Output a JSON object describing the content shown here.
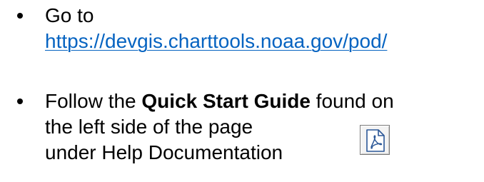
{
  "bullets": [
    {
      "lead": "Go to",
      "link": "https://devgis.charttools.noaa.gov/pod/"
    },
    {
      "pre": "Follow the ",
      "bold": "Quick Start Guide",
      "post": " found on",
      "line2": "the left side of the page",
      "line3": "under Help Documentation"
    }
  ],
  "pdf_button": {
    "icon": "pdf-file-icon"
  }
}
